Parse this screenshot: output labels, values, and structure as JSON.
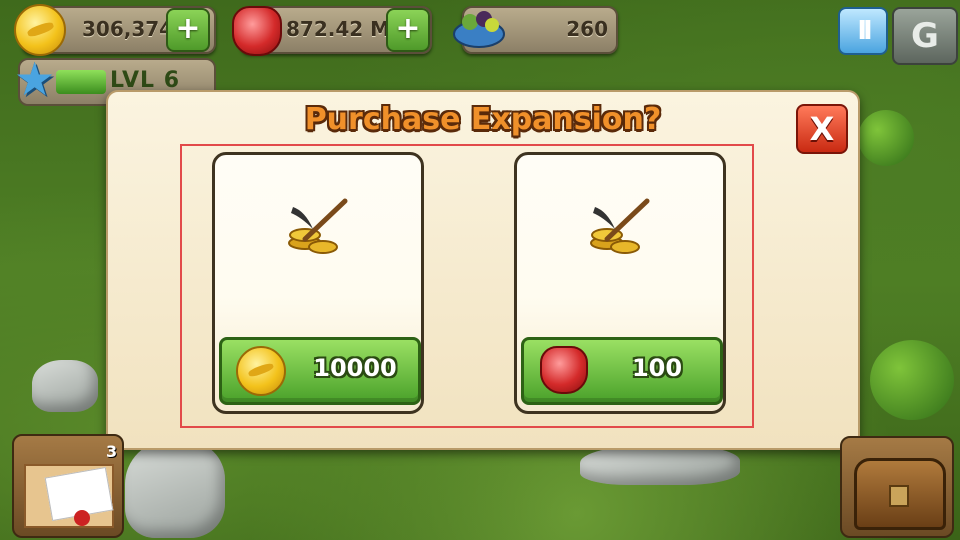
{
  "hud": {
    "coins": "306,374",
    "gems": "872.42 M",
    "food": "260",
    "add_coins_label": "+",
    "add_gems_label": "+",
    "level_text": "LVL 6",
    "pause_label": "II",
    "gameloft_label": "G"
  },
  "modal": {
    "title": "Purchase Expansion?",
    "close_label": "X",
    "options": [
      {
        "price": "10000",
        "currency": "coin"
      },
      {
        "price": "100",
        "currency": "gem"
      }
    ]
  },
  "mail": {
    "badge": "3"
  },
  "icons": [
    "coin-icon",
    "gem-icon",
    "food-bowl-icon",
    "star-icon",
    "pickaxe-icon",
    "mail-icon",
    "chest-icon"
  ]
}
